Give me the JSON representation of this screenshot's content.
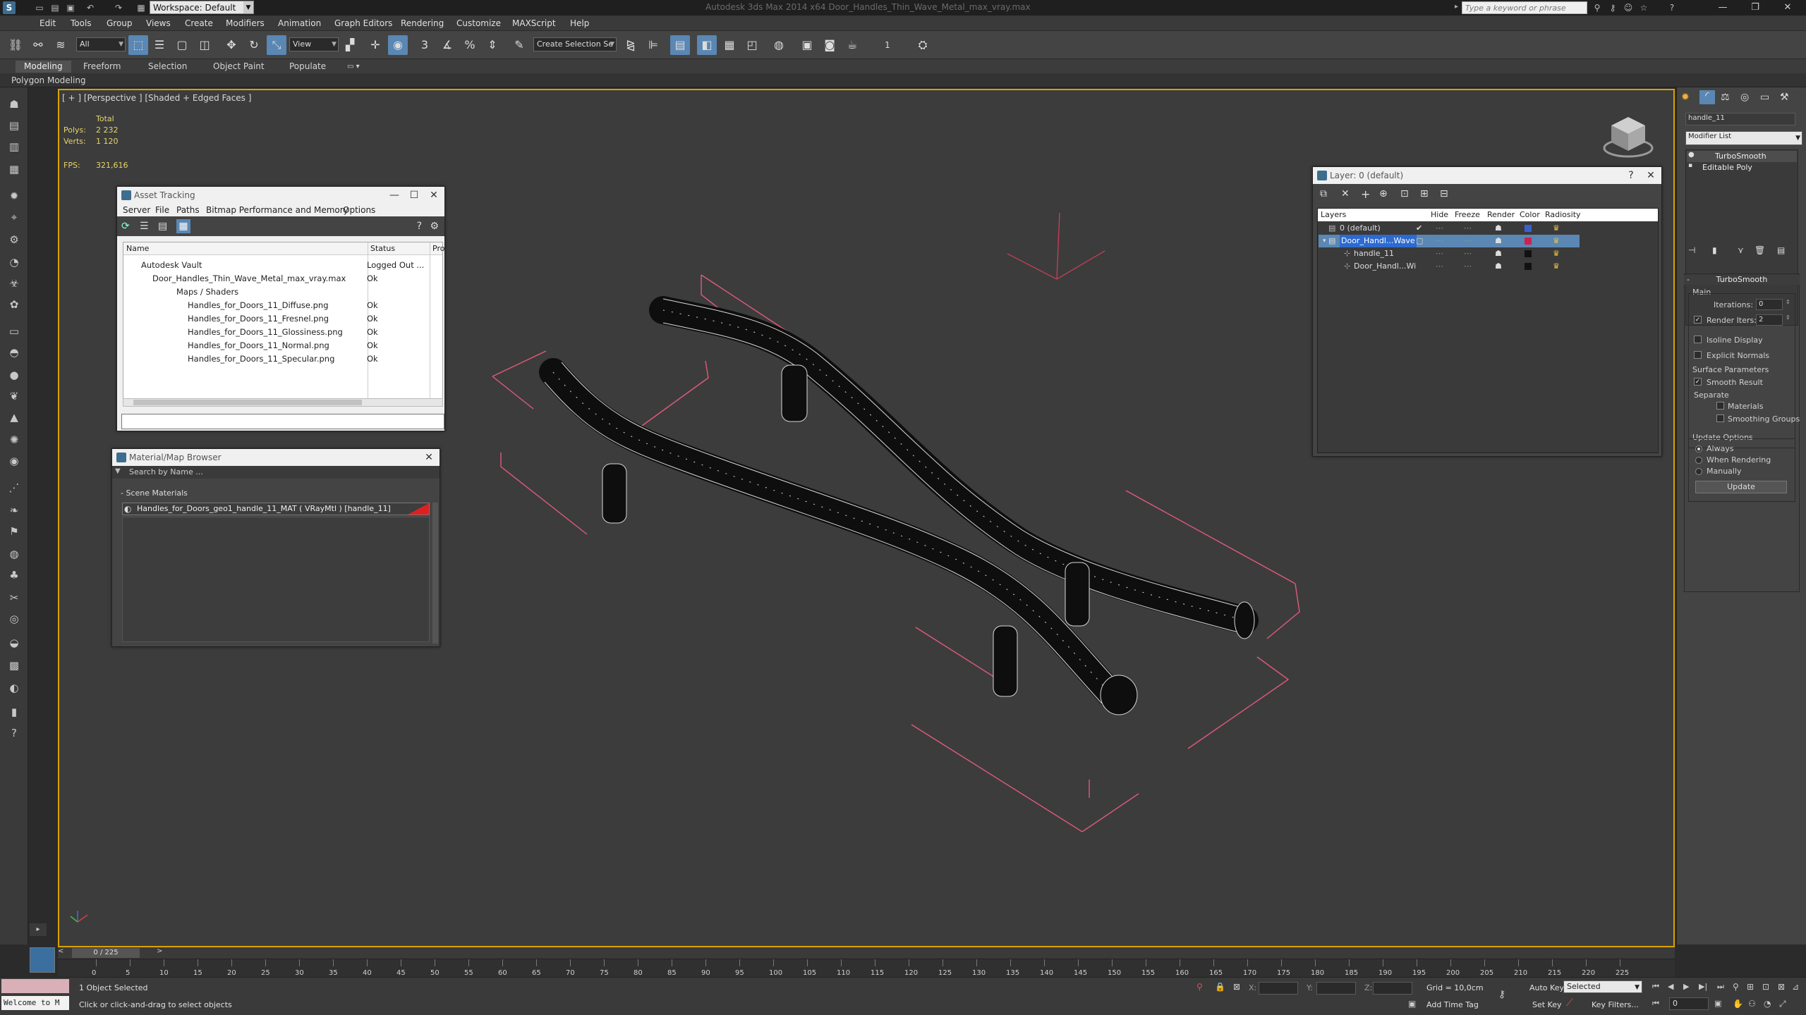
{
  "window": {
    "title": "Autodesk 3ds Max 2014 x64     Door_Handles_Thin_Wave_Metal_max_vray.max",
    "workspace": "Workspace: Default",
    "search_placeholder": "Type a keyword or phrase"
  },
  "menu": [
    "Edit",
    "Tools",
    "Group",
    "Views",
    "Create",
    "Modifiers",
    "Animation",
    "Graph Editors",
    "Rendering",
    "Customize",
    "MAXScript",
    "Help"
  ],
  "toolbar": {
    "filter_select": "All",
    "ref_coord_select": "View",
    "selection_set": "Create Selection Se",
    "counter": "1"
  },
  "ribbon": {
    "tabs": [
      "Modeling",
      "Freeform",
      "Selection",
      "Object Paint",
      "Populate"
    ],
    "active_tab": "Modeling",
    "panel_label": "Polygon Modeling"
  },
  "viewport": {
    "label": "[ + ] [Perspective ] [Shaded + Edged Faces ]",
    "stats": {
      "total_label": "Total",
      "polys_label": "Polys:",
      "polys_value": "2 232",
      "verts_label": "Verts:",
      "verts_value": "1 120",
      "fps_label": "FPS:",
      "fps_value": "321,616"
    }
  },
  "asset_tracking": {
    "title": "Asset Tracking",
    "menu": [
      "Server",
      "File",
      "Paths",
      "Bitmap Performance and Memory",
      "Options"
    ],
    "columns": [
      "Name",
      "Status",
      "Pro"
    ],
    "rows": [
      {
        "name": "Autodesk Vault",
        "status": "Logged Out ..."
      },
      {
        "name": "Door_Handles_Thin_Wave_Metal_max_vray.max",
        "status": "Ok"
      },
      {
        "name": "Maps / Shaders",
        "status": ""
      },
      {
        "name": "Handles_for_Doors_11_Diffuse.png",
        "status": "Ok"
      },
      {
        "name": "Handles_for_Doors_11_Fresnel.png",
        "status": "Ok"
      },
      {
        "name": "Handles_for_Doors_11_Glossiness.png",
        "status": "Ok"
      },
      {
        "name": "Handles_for_Doors_11_Normal.png",
        "status": "Ok"
      },
      {
        "name": "Handles_for_Doors_11_Specular.png",
        "status": "Ok"
      }
    ]
  },
  "material_browser": {
    "title": "Material/Map Browser",
    "search_placeholder": "Search by Name ...",
    "group": "- Scene Materials",
    "item": "Handles_for_Doors_geo1_handle_11_MAT ( VRayMtl ) [handle_11]"
  },
  "layer_explorer": {
    "title": "Layer: 0 (default)",
    "columns": [
      "Layers",
      "Hide",
      "Freeze",
      "Render",
      "Color",
      "Radiosity"
    ],
    "rows": [
      {
        "name": "0 (default)",
        "color": "#3a5fd0"
      },
      {
        "name": "Door_Handl...Wave",
        "color": "#d02050"
      },
      {
        "name": "handle_11",
        "color": "#111111"
      },
      {
        "name": "Door_Handl...Wi",
        "color": "#111111"
      }
    ]
  },
  "command_panel": {
    "object_name": "handle_11",
    "modifier_list": "Modifier List",
    "stack": [
      "TurboSmooth",
      "Editable Poly"
    ],
    "rollout_title": "TurboSmooth",
    "main_label": "Main",
    "iterations_label": "Iterations:",
    "iterations_value": "0",
    "render_iters_label": "Render Iters:",
    "render_iters_value": "2",
    "isoline_label": "Isoline Display",
    "explicit_normals_label": "Explicit Normals",
    "surface_params_label": "Surface Parameters",
    "smooth_result_label": "Smooth Result",
    "separate_label": "Separate",
    "materials_label": "Materials",
    "smoothing_groups_label": "Smoothing Groups",
    "update_options_label": "Update Options",
    "always_label": "Always",
    "when_rendering_label": "When Rendering",
    "manually_label": "Manually",
    "update_button": "Update"
  },
  "timeline": {
    "frame": "0 / 225",
    "ticks": [
      "0",
      "5",
      "10",
      "15",
      "20",
      "25",
      "30",
      "35",
      "40",
      "45",
      "50",
      "55",
      "60",
      "65",
      "70",
      "75",
      "80",
      "85",
      "90",
      "95",
      "100",
      "105",
      "110",
      "115",
      "120",
      "125",
      "130",
      "135",
      "140",
      "145",
      "150",
      "155",
      "160",
      "165",
      "170",
      "175",
      "180",
      "185",
      "190",
      "195",
      "200",
      "205",
      "210",
      "215",
      "220",
      "225"
    ]
  },
  "status": {
    "maxscript": "Welcome to M",
    "selected": "1 Object Selected",
    "prompt": "Click or click-and-drag to select objects",
    "x_label": "X:",
    "y_label": "Y:",
    "z_label": "Z:",
    "grid": "Grid = 10,0cm",
    "auto_key": "Auto Key",
    "selected_dropdown": "Selected",
    "set_key": "Set Key",
    "key_filters": "Key Filters...",
    "add_time_tag": "Add Time Tag",
    "frame_field": "0"
  }
}
